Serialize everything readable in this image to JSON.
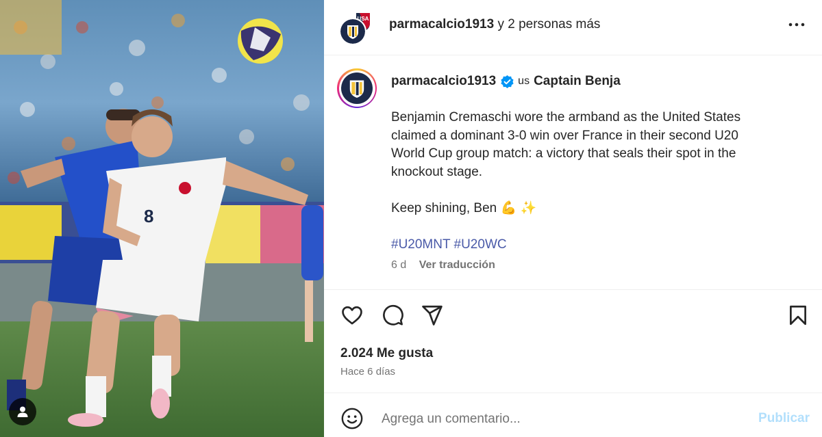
{
  "photo": {
    "alt_icon": "user-tag-icon",
    "jersey_number": "8",
    "crest_text": "USA"
  },
  "header": {
    "username": "parmacalcio1913",
    "others_text": "y 2 personas más",
    "more_icon": "more-horizontal-icon"
  },
  "caption": {
    "username": "parmacalcio1913",
    "flag": "us",
    "title": "Captain Benja",
    "lines": [
      "Benjamin Cremaschi wore the armband as the United States",
      "claimed a dominant 3-0 win over France in their second U20",
      "World Cup group match: a victory that seals their spot in the",
      "knockout stage."
    ],
    "closing": "Keep shining, Ben 💪 ✨",
    "hashtags": [
      "#U20MNT",
      "#U20WC"
    ],
    "time_ago": "6 d",
    "translate_label": "Ver traducción"
  },
  "actions": {
    "likes": "2.024 Me gusta",
    "posted": "Hace 6 días"
  },
  "comment": {
    "placeholder": "Agrega un comentario...",
    "publish_label": "Publicar"
  },
  "colors": {
    "hashtag": "#4a5aa8",
    "publish_disabled": "#b2dffc",
    "verified": "#0095f6",
    "parma_navy": "#1c2a4a",
    "parma_gold": "#f3c33b"
  }
}
